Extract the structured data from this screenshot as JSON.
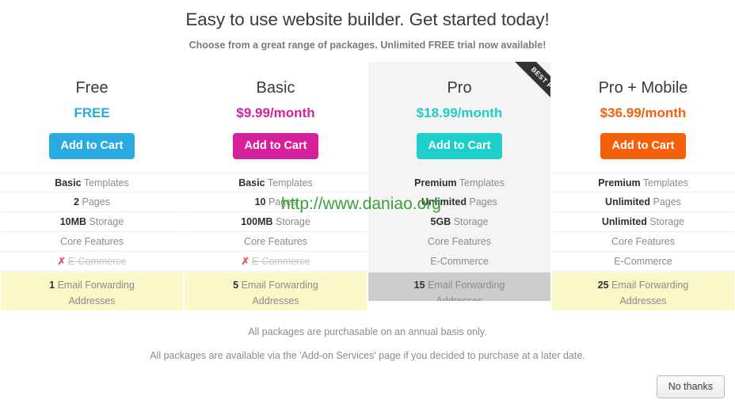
{
  "header": {
    "headline": "Easy to use website builder. Get started today!",
    "subhead": "Choose from a great range of packages. Unlimited FREE trial now available!"
  },
  "ribbon": {
    "label": "BEST PRICE"
  },
  "watermark": {
    "text": "http://www.daniao.org",
    "color": "#3aa03a"
  },
  "plans": [
    {
      "name": "Free",
      "price": "FREE",
      "price_color": "#29ABE2",
      "button_label": "Add to Cart",
      "button_color": "#29ABE2",
      "featured": false,
      "features": [
        {
          "bold": "Basic",
          "text": "Templates",
          "disabled": false
        },
        {
          "bold": "2",
          "text": "Pages",
          "disabled": false
        },
        {
          "bold": "10MB",
          "text": "Storage",
          "disabled": false
        },
        {
          "bold": "",
          "text": "Core Features",
          "disabled": false
        },
        {
          "bold": "",
          "text": "E-Commerce",
          "disabled": true
        }
      ],
      "email_count": "1",
      "email_label": "Email Forwarding",
      "email_label2": "Addresses"
    },
    {
      "name": "Basic",
      "price": "$9.99/month",
      "price_color": "#D6219B",
      "button_label": "Add to Cart",
      "button_color": "#D6219B",
      "featured": false,
      "features": [
        {
          "bold": "Basic",
          "text": "Templates",
          "disabled": false
        },
        {
          "bold": "10",
          "text": "Pages",
          "disabled": false
        },
        {
          "bold": "100MB",
          "text": "Storage",
          "disabled": false
        },
        {
          "bold": "",
          "text": "Core Features",
          "disabled": false
        },
        {
          "bold": "",
          "text": "E-Commerce",
          "disabled": true
        }
      ],
      "email_count": "5",
      "email_label": "Email Forwarding",
      "email_label2": "Addresses"
    },
    {
      "name": "Pro",
      "price": "$18.99/month",
      "price_color": "#1ECECA",
      "button_label": "Add to Cart",
      "button_color": "#1ECECA",
      "featured": true,
      "features": [
        {
          "bold": "Premium",
          "text": "Templates",
          "disabled": false
        },
        {
          "bold": "Unlimited",
          "text": "Pages",
          "disabled": false
        },
        {
          "bold": "5GB",
          "text": "Storage",
          "disabled": false
        },
        {
          "bold": "",
          "text": "Core Features",
          "disabled": false
        },
        {
          "bold": "",
          "text": "E-Commerce",
          "disabled": false
        }
      ],
      "email_count": "15",
      "email_label": "Email Forwarding",
      "email_label2": "Addresses"
    },
    {
      "name": "Pro + Mobile",
      "price": "$36.99/month",
      "price_color": "#F4600C",
      "button_label": "Add to Cart",
      "button_color": "#F4600C",
      "featured": false,
      "features": [
        {
          "bold": "Premium",
          "text": "Templates",
          "disabled": false
        },
        {
          "bold": "Unlimited",
          "text": "Pages",
          "disabled": false
        },
        {
          "bold": "Unlimited",
          "text": "Storage",
          "disabled": false
        },
        {
          "bold": "",
          "text": "Core Features",
          "disabled": false
        },
        {
          "bold": "",
          "text": "E-Commerce",
          "disabled": false
        }
      ],
      "email_count": "25",
      "email_label": "Email Forwarding",
      "email_label2": "Addresses"
    }
  ],
  "notes": {
    "line1": "All packages are purchasable on an annual basis only.",
    "line2": "All packages are available via the 'Add-on Services' page if you decided to purchase at a later date."
  },
  "actions": {
    "decline_label": "No thanks"
  },
  "icons": {
    "cross": "✗"
  }
}
